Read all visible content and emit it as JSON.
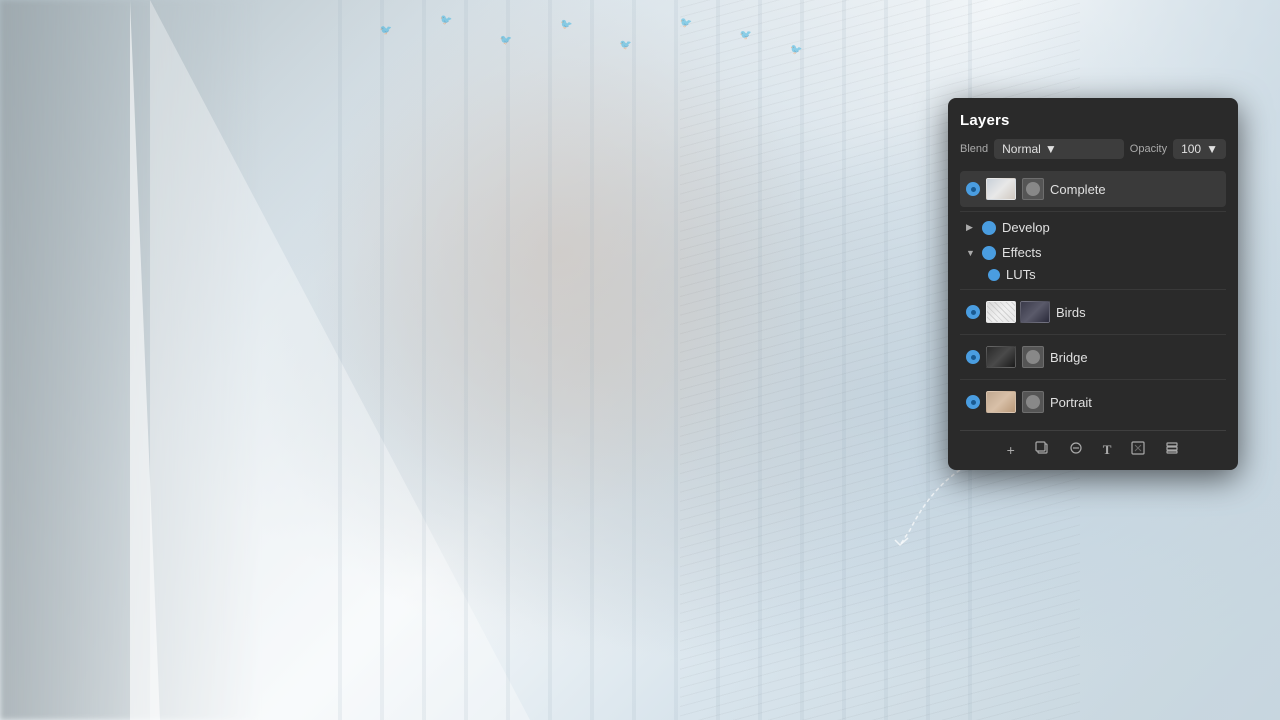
{
  "background": {
    "description": "Double exposure portrait composite with birds, bridge, and geometric elements",
    "primaryColor": "#ccd8e0"
  },
  "panel": {
    "title": "Layers",
    "blend_label": "Blend",
    "blend_mode": "Normal",
    "opacity_label": "Opacity",
    "opacity_value": "100",
    "layers": [
      {
        "id": "complete",
        "name": "Complete",
        "type": "image",
        "visible": true,
        "thumbnail": "complete"
      },
      {
        "id": "develop",
        "name": "Develop",
        "type": "group",
        "expanded": false,
        "visible": true
      },
      {
        "id": "effects",
        "name": "Effects",
        "type": "group",
        "expanded": true,
        "visible": true,
        "children": [
          {
            "id": "luts",
            "name": "LUTs",
            "type": "item",
            "visible": true
          }
        ]
      },
      {
        "id": "birds",
        "name": "Birds",
        "type": "image",
        "visible": true,
        "thumbnail": "birds"
      },
      {
        "id": "bridge",
        "name": "Bridge",
        "type": "image",
        "visible": true,
        "thumbnail": "bridge"
      },
      {
        "id": "portrait",
        "name": "Portrait",
        "type": "image",
        "visible": true,
        "thumbnail": "portrait"
      }
    ],
    "toolbar": {
      "add": "+",
      "duplicate": "⧉",
      "erase": "◈",
      "text": "T",
      "mask": "⬜",
      "stack": "⊞"
    }
  }
}
